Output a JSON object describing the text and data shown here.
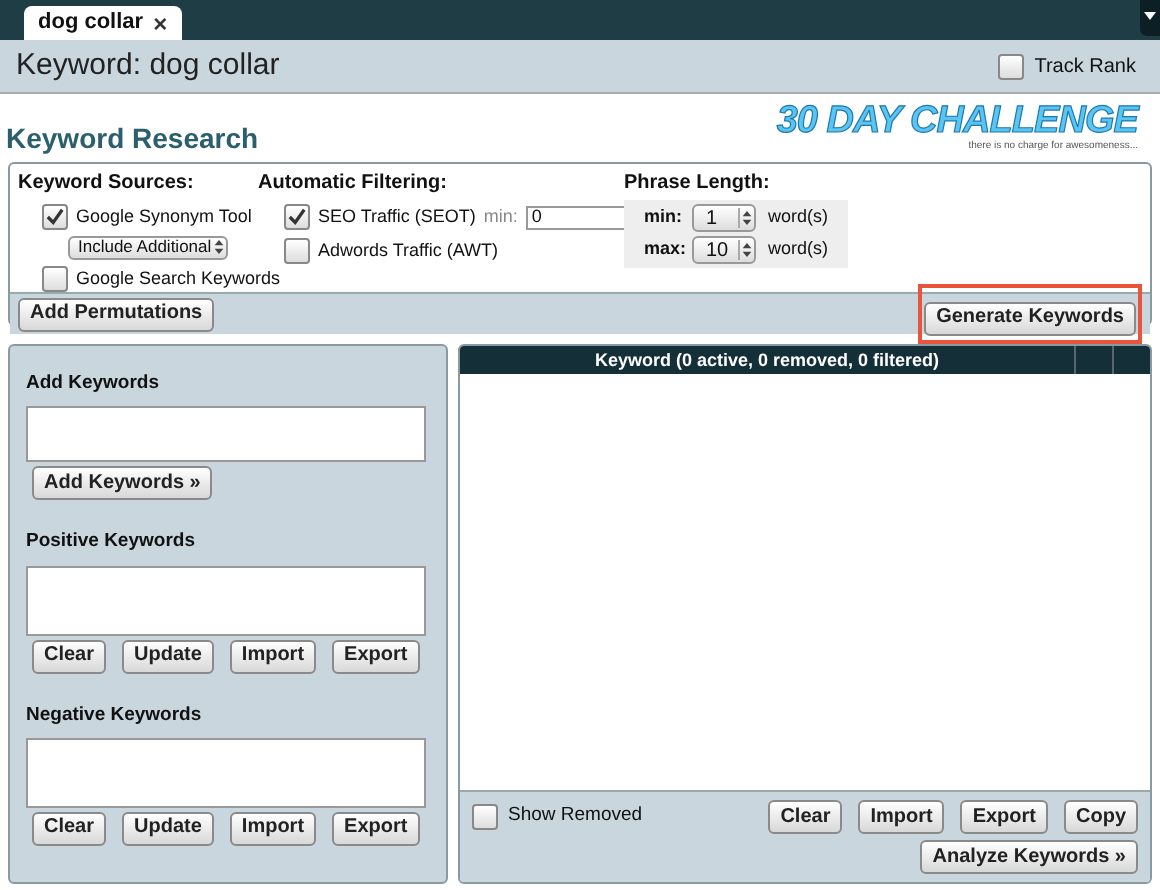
{
  "tab": {
    "label": "dog collar",
    "close": "×",
    "selected": true
  },
  "header": {
    "title": "Keyword: dog collar",
    "track_rank": {
      "label": "Track Rank",
      "checked": false
    }
  },
  "section_title": "Keyword Research",
  "logo": {
    "title": "30 DAY CHALLENGE",
    "tagline": "there is no charge for awesomeness..."
  },
  "sources": {
    "heading": "Keyword Sources:",
    "items": [
      {
        "label": "Google Synonym Tool",
        "checked": true,
        "select": "Include Additional"
      },
      {
        "label": "Google Search Keywords",
        "checked": false
      }
    ]
  },
  "filtering": {
    "heading": "Automatic Filtering:",
    "items": [
      {
        "label": "SEO Traffic (SEOT)",
        "checked": true,
        "min_label": "min:",
        "min_value": "0"
      },
      {
        "label": "Adwords Traffic (AWT)",
        "checked": false
      }
    ]
  },
  "phrase_length": {
    "heading": "Phrase Length:",
    "rows": [
      {
        "label": "min:",
        "value": "1",
        "unit": "word(s)"
      },
      {
        "label": "max:",
        "value": "10",
        "unit": "word(s)"
      }
    ]
  },
  "add_permutations": "Add Permutations",
  "generate": {
    "label": "Generate Keywords",
    "highlighted": true
  },
  "left_panel": {
    "sections": [
      {
        "heading": "Add Keywords",
        "buttons": [
          "Add Keywords »"
        ]
      },
      {
        "heading": "Positive Keywords",
        "buttons": [
          "Clear",
          "Update",
          "Import",
          "Export"
        ]
      },
      {
        "heading": "Negative Keywords",
        "buttons": [
          "Clear",
          "Update",
          "Import",
          "Export"
        ]
      }
    ]
  },
  "table": {
    "columns": [
      "Keyword (0 active, 0 removed, 0 filtered)"
    ],
    "show_removed": {
      "label": "Show Removed",
      "checked": false
    },
    "buttons": [
      "Clear",
      "Import",
      "Export",
      "Copy"
    ],
    "analyze": "Analyze Keywords »"
  }
}
